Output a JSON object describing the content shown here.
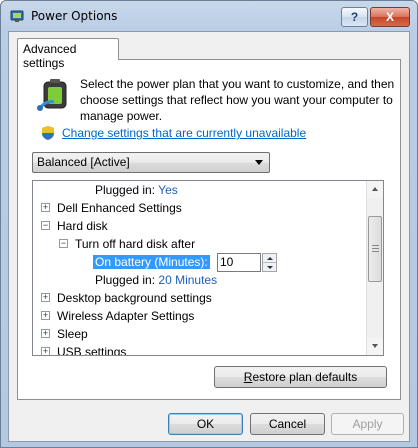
{
  "window": {
    "title": "Power Options",
    "help_label": "?",
    "close_label": "X"
  },
  "tab": {
    "label": "Advanced settings"
  },
  "intro": {
    "text": "Select the power plan that you want to customize, and then choose settings that reflect how you want your computer to manage power."
  },
  "change_link": {
    "text": "Change settings that are currently unavailable"
  },
  "plan": {
    "selected": "Balanced [Active]"
  },
  "tree": {
    "plugged_in_label": "Plugged in:",
    "plugged_in_top_value": "Yes",
    "dell": "Dell Enhanced Settings",
    "hard_disk": "Hard disk",
    "turn_off": "Turn off hard disk after",
    "on_battery_label": "On battery (Minutes):",
    "on_battery_value": "10",
    "plugged_in_value": "20 Minutes",
    "desktop_bg": "Desktop background settings",
    "wireless": "Wireless Adapter Settings",
    "sleep": "Sleep",
    "usb": "USB settings",
    "expand_plus": "+",
    "expand_minus": "−"
  },
  "buttons": {
    "restore_pre": "R",
    "restore_rest": "estore plan defaults",
    "ok": "OK",
    "cancel": "Cancel",
    "apply": "Apply"
  }
}
